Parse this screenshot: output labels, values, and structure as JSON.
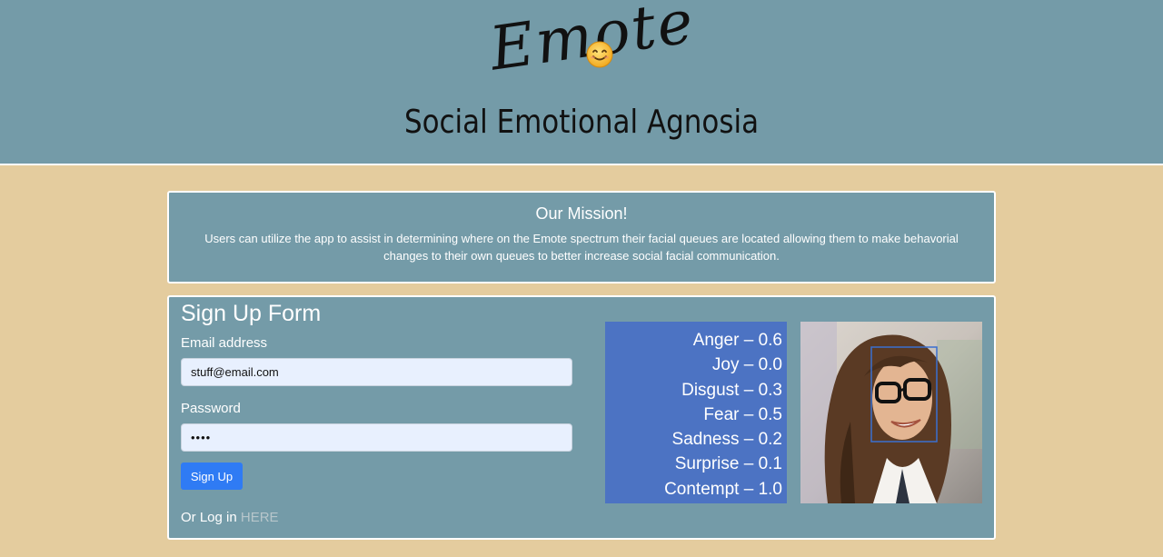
{
  "header": {
    "logo_text": "Emote",
    "subtitle": "Social Emotional Agnosia"
  },
  "mission": {
    "title": "Our Mission!",
    "text": "Users can utilize the app to assist in determining where on the Emote spectrum their facial queues are located allowing them to make behavorial changes to their own queues to better increase social facial communication."
  },
  "signup": {
    "title": "Sign Up Form",
    "email_label": "Email address",
    "email_value": "stuff@email.com",
    "password_label": "Password",
    "password_value": "••••",
    "button_label": "Sign Up",
    "login_prefix": "Or Log in",
    "login_link": "HERE"
  },
  "emotions": [
    "Anger – 0.6",
    "Joy – 0.0",
    "Disgust – 0.3",
    "Fear – 0.5",
    "Sadness – 0.2",
    "Surprise – 0.1",
    "Contempt – 1.0"
  ],
  "icons": {
    "logo_emoji": "smiling-face-icon",
    "photo": "face-detection-photo"
  },
  "colors": {
    "header_bg": "#749ba8",
    "page_bg": "#e4cc9e",
    "emotion_panel": "#4c73c3",
    "button": "#2f7bf4"
  }
}
